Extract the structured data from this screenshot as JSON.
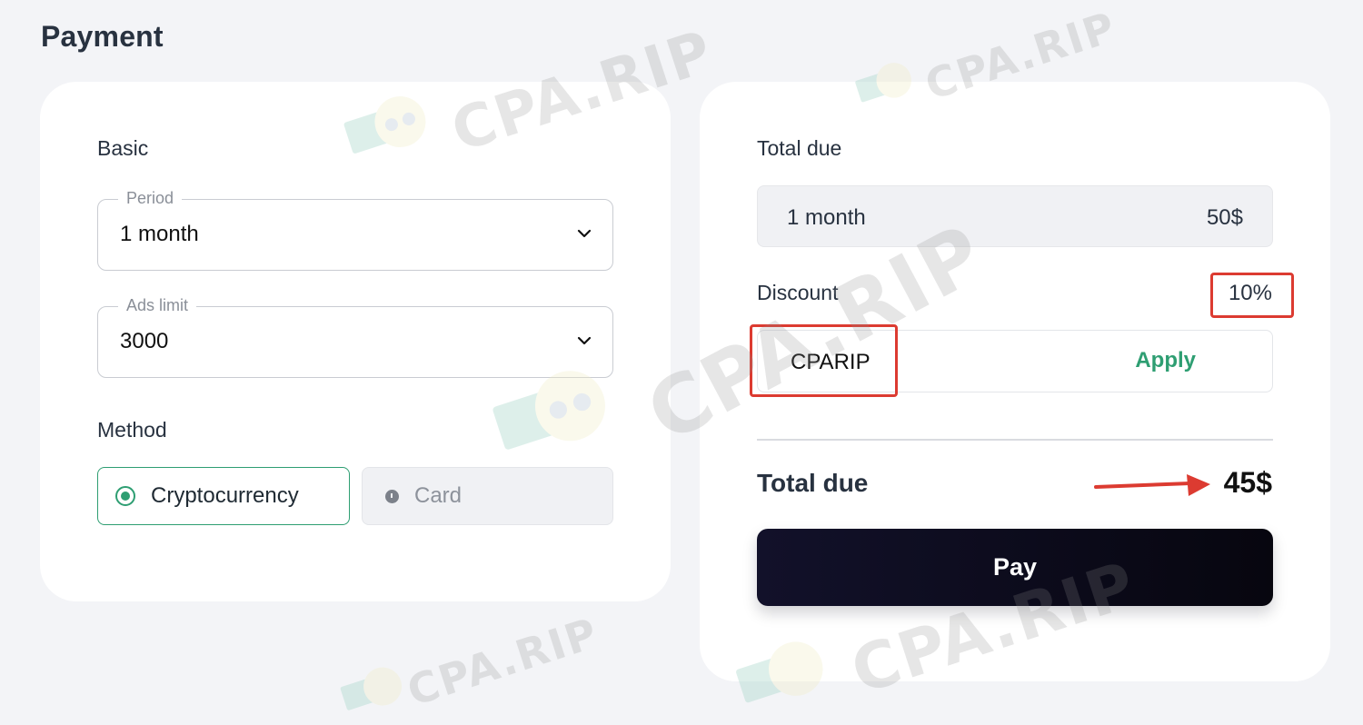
{
  "page": {
    "title": "Payment"
  },
  "basic": {
    "section_label": "Basic",
    "period": {
      "legend": "Period",
      "value": "1 month"
    },
    "ads_limit": {
      "legend": "Ads limit",
      "value": "3000"
    },
    "method": {
      "label": "Method",
      "options": [
        {
          "label": "Cryptocurrency",
          "selected": true
        },
        {
          "label": "Card",
          "selected": false
        }
      ]
    }
  },
  "summary": {
    "total_due_label": "Total due",
    "line_item": {
      "name": "1 month",
      "price": "50$"
    },
    "discount": {
      "label": "Discount",
      "percent": "10%"
    },
    "coupon": {
      "value": "CPARIP",
      "apply_label": "Apply"
    },
    "total": {
      "label": "Total due",
      "amount": "45$"
    },
    "pay_label": "Pay"
  },
  "watermark": {
    "text": "CPA.RIP"
  },
  "colors": {
    "accent": "#2e9e72",
    "highlight": "#dc3b31",
    "pay_button": "#0c0b1e",
    "background": "#f3f4f7"
  }
}
